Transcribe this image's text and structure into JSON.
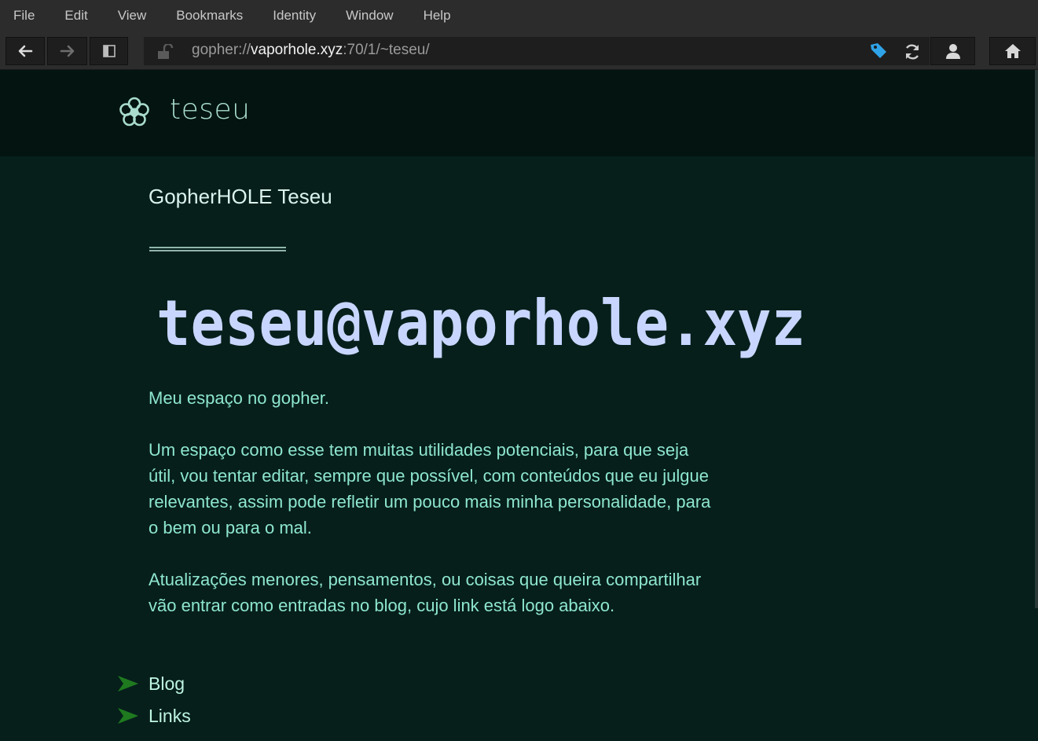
{
  "menu": [
    "File",
    "Edit",
    "View",
    "Bookmarks",
    "Identity",
    "Window",
    "Help"
  ],
  "toolbar": {
    "url_scheme": "gopher://",
    "url_host": "vaporhole.xyz",
    "url_path": ":70/1/~teseu/",
    "icons": [
      "back-arrow-icon",
      "forward-arrow-icon",
      "sidebar-icon",
      "unlocked-padlock-icon",
      "bookmark-icon",
      "reload-icon",
      "identity-icon",
      "home-icon"
    ]
  },
  "site": {
    "title": "teseu",
    "icon": "flower-icon",
    "accent": "#a9dccd"
  },
  "page": {
    "heading": "GopherHOLE Teseu",
    "rule": "================",
    "banner": "teseu@vaporhole.xyz",
    "paragraphs": [
      "Meu espaço no gopher.",
      "Um espaço como esse tem muitas utilidades potenciais, para que seja útil, vou tentar editar, sempre que possível, com conteúdos que eu julgue relevantes, assim pode refletir um pouco mais minha personalidade, para o bem ou para o mal.",
      "Atualizações menores, pensamentos, ou coisas que queira compartilhar vão entrar como entradas no blog, cujo link está logo abaixo."
    ],
    "links": [
      "Blog",
      "Links"
    ],
    "colors": {
      "background": "#061f1b",
      "header_band": "#031411",
      "text": "#8ee6cf",
      "banner": "#c8d6ff",
      "link_arrow": "#1f7a1f"
    }
  }
}
